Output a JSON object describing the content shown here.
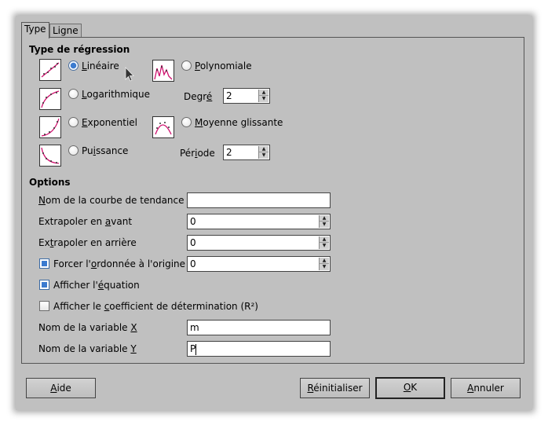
{
  "tabs": [
    {
      "label": "Type",
      "active": true
    },
    {
      "label": "Ligne",
      "active": false
    }
  ],
  "regression": {
    "title": "Type de régression",
    "types": [
      {
        "pre": "",
        "key": "L",
        "post": "inéaire",
        "checked": true
      },
      {
        "pre": "",
        "key": "L",
        "post": "ogarithmique",
        "checked": false
      },
      {
        "pre": "",
        "key": "E",
        "post": "xponentiel",
        "checked": false
      },
      {
        "pre": "Pu",
        "key": "i",
        "post": "ssance",
        "checked": false
      },
      {
        "pre": "",
        "key": "P",
        "post": "olynomiale",
        "checked": false
      },
      {
        "pre": "",
        "key": "M",
        "post": "oyenne glissante",
        "checked": false
      }
    ],
    "degree": {
      "pre": "Degr",
      "key": "é",
      "post": "",
      "value": "2"
    },
    "period": {
      "pre": "Pér",
      "key": "i",
      "post": "ode",
      "value": "2"
    }
  },
  "options": {
    "title": "Options",
    "trendline_name": {
      "pre": "",
      "key": "N",
      "post": "om de la courbe de tendance",
      "value": ""
    },
    "extrapolate_forward": {
      "pre": "Extrapoler en ",
      "key": "a",
      "post": "vant",
      "value": "0"
    },
    "extrapolate_backward": {
      "pre": "Ex",
      "key": "t",
      "post": "rapoler en arrière",
      "value": "0"
    },
    "force_intercept": {
      "pre": "Forcer l'",
      "key": "o",
      "post": "rdonnée à l'origine",
      "checked": true,
      "value": "0"
    },
    "show_equation": {
      "pre": "Afficher l'",
      "key": "é",
      "post": "quation",
      "checked": true
    },
    "show_r2": {
      "pre": "Afficher le ",
      "key": "c",
      "post": "oefficient de détermination (R²)",
      "checked": false
    },
    "var_x": {
      "pre": "Nom de la variable ",
      "key": "X",
      "post": "",
      "value": "m"
    },
    "var_y": {
      "pre": "Nom de la variable ",
      "key": "Y",
      "post": "",
      "value": "P"
    }
  },
  "buttons": {
    "help": {
      "pre": "",
      "key": "A",
      "post": "ide"
    },
    "reset": {
      "pre": "",
      "key": "R",
      "post": "éinitialiser"
    },
    "ok": {
      "pre": "",
      "key": "O",
      "post": "K"
    },
    "cancel": {
      "pre": "",
      "key": "A",
      "post": "nnuler"
    }
  },
  "colors": {
    "accent": "#3b7bd0",
    "dialog_bg": "#c0c0c0",
    "curve": "#d0106e"
  }
}
